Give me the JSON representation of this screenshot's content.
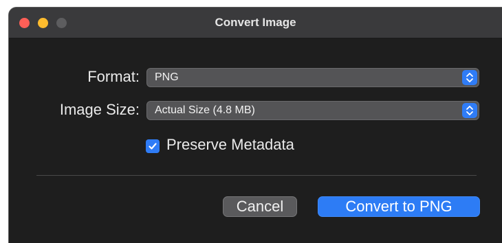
{
  "window": {
    "title": "Convert Image"
  },
  "form": {
    "format_label": "Format:",
    "format_value": "PNG",
    "size_label": "Image Size:",
    "size_value": "Actual Size (4.8 MB)",
    "preserve_metadata_label": "Preserve Metadata",
    "preserve_metadata_checked": true
  },
  "buttons": {
    "cancel_label": "Cancel",
    "convert_label": "Convert to PNG"
  },
  "colors": {
    "accent": "#2f7cf6",
    "close": "#ff5f57",
    "minimize": "#febc2e",
    "background": "#1e1e1e"
  }
}
